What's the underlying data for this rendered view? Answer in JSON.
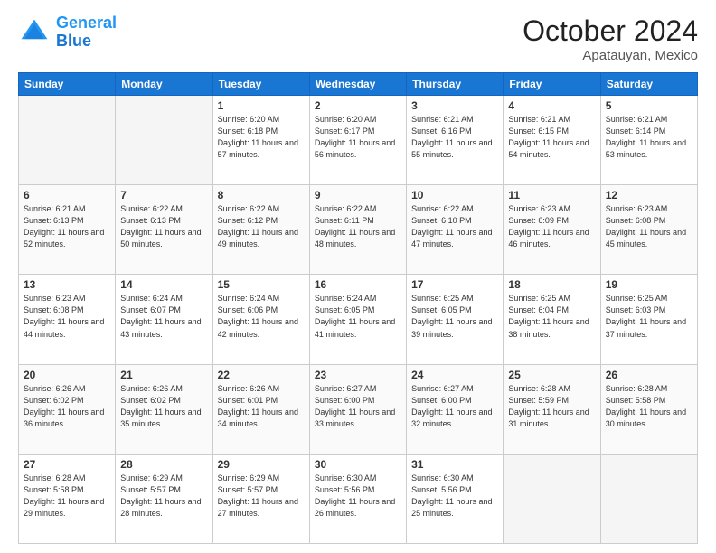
{
  "header": {
    "logo_line1": "General",
    "logo_line2": "Blue",
    "month": "October 2024",
    "location": "Apatauyan, Mexico"
  },
  "days_of_week": [
    "Sunday",
    "Monday",
    "Tuesday",
    "Wednesday",
    "Thursday",
    "Friday",
    "Saturday"
  ],
  "weeks": [
    [
      {
        "num": "",
        "info": ""
      },
      {
        "num": "",
        "info": ""
      },
      {
        "num": "1",
        "info": "Sunrise: 6:20 AM\nSunset: 6:18 PM\nDaylight: 11 hours and 57 minutes."
      },
      {
        "num": "2",
        "info": "Sunrise: 6:20 AM\nSunset: 6:17 PM\nDaylight: 11 hours and 56 minutes."
      },
      {
        "num": "3",
        "info": "Sunrise: 6:21 AM\nSunset: 6:16 PM\nDaylight: 11 hours and 55 minutes."
      },
      {
        "num": "4",
        "info": "Sunrise: 6:21 AM\nSunset: 6:15 PM\nDaylight: 11 hours and 54 minutes."
      },
      {
        "num": "5",
        "info": "Sunrise: 6:21 AM\nSunset: 6:14 PM\nDaylight: 11 hours and 53 minutes."
      }
    ],
    [
      {
        "num": "6",
        "info": "Sunrise: 6:21 AM\nSunset: 6:13 PM\nDaylight: 11 hours and 52 minutes."
      },
      {
        "num": "7",
        "info": "Sunrise: 6:22 AM\nSunset: 6:13 PM\nDaylight: 11 hours and 50 minutes."
      },
      {
        "num": "8",
        "info": "Sunrise: 6:22 AM\nSunset: 6:12 PM\nDaylight: 11 hours and 49 minutes."
      },
      {
        "num": "9",
        "info": "Sunrise: 6:22 AM\nSunset: 6:11 PM\nDaylight: 11 hours and 48 minutes."
      },
      {
        "num": "10",
        "info": "Sunrise: 6:22 AM\nSunset: 6:10 PM\nDaylight: 11 hours and 47 minutes."
      },
      {
        "num": "11",
        "info": "Sunrise: 6:23 AM\nSunset: 6:09 PM\nDaylight: 11 hours and 46 minutes."
      },
      {
        "num": "12",
        "info": "Sunrise: 6:23 AM\nSunset: 6:08 PM\nDaylight: 11 hours and 45 minutes."
      }
    ],
    [
      {
        "num": "13",
        "info": "Sunrise: 6:23 AM\nSunset: 6:08 PM\nDaylight: 11 hours and 44 minutes."
      },
      {
        "num": "14",
        "info": "Sunrise: 6:24 AM\nSunset: 6:07 PM\nDaylight: 11 hours and 43 minutes."
      },
      {
        "num": "15",
        "info": "Sunrise: 6:24 AM\nSunset: 6:06 PM\nDaylight: 11 hours and 42 minutes."
      },
      {
        "num": "16",
        "info": "Sunrise: 6:24 AM\nSunset: 6:05 PM\nDaylight: 11 hours and 41 minutes."
      },
      {
        "num": "17",
        "info": "Sunrise: 6:25 AM\nSunset: 6:05 PM\nDaylight: 11 hours and 39 minutes."
      },
      {
        "num": "18",
        "info": "Sunrise: 6:25 AM\nSunset: 6:04 PM\nDaylight: 11 hours and 38 minutes."
      },
      {
        "num": "19",
        "info": "Sunrise: 6:25 AM\nSunset: 6:03 PM\nDaylight: 11 hours and 37 minutes."
      }
    ],
    [
      {
        "num": "20",
        "info": "Sunrise: 6:26 AM\nSunset: 6:02 PM\nDaylight: 11 hours and 36 minutes."
      },
      {
        "num": "21",
        "info": "Sunrise: 6:26 AM\nSunset: 6:02 PM\nDaylight: 11 hours and 35 minutes."
      },
      {
        "num": "22",
        "info": "Sunrise: 6:26 AM\nSunset: 6:01 PM\nDaylight: 11 hours and 34 minutes."
      },
      {
        "num": "23",
        "info": "Sunrise: 6:27 AM\nSunset: 6:00 PM\nDaylight: 11 hours and 33 minutes."
      },
      {
        "num": "24",
        "info": "Sunrise: 6:27 AM\nSunset: 6:00 PM\nDaylight: 11 hours and 32 minutes."
      },
      {
        "num": "25",
        "info": "Sunrise: 6:28 AM\nSunset: 5:59 PM\nDaylight: 11 hours and 31 minutes."
      },
      {
        "num": "26",
        "info": "Sunrise: 6:28 AM\nSunset: 5:58 PM\nDaylight: 11 hours and 30 minutes."
      }
    ],
    [
      {
        "num": "27",
        "info": "Sunrise: 6:28 AM\nSunset: 5:58 PM\nDaylight: 11 hours and 29 minutes."
      },
      {
        "num": "28",
        "info": "Sunrise: 6:29 AM\nSunset: 5:57 PM\nDaylight: 11 hours and 28 minutes."
      },
      {
        "num": "29",
        "info": "Sunrise: 6:29 AM\nSunset: 5:57 PM\nDaylight: 11 hours and 27 minutes."
      },
      {
        "num": "30",
        "info": "Sunrise: 6:30 AM\nSunset: 5:56 PM\nDaylight: 11 hours and 26 minutes."
      },
      {
        "num": "31",
        "info": "Sunrise: 6:30 AM\nSunset: 5:56 PM\nDaylight: 11 hours and 25 minutes."
      },
      {
        "num": "",
        "info": ""
      },
      {
        "num": "",
        "info": ""
      }
    ]
  ]
}
